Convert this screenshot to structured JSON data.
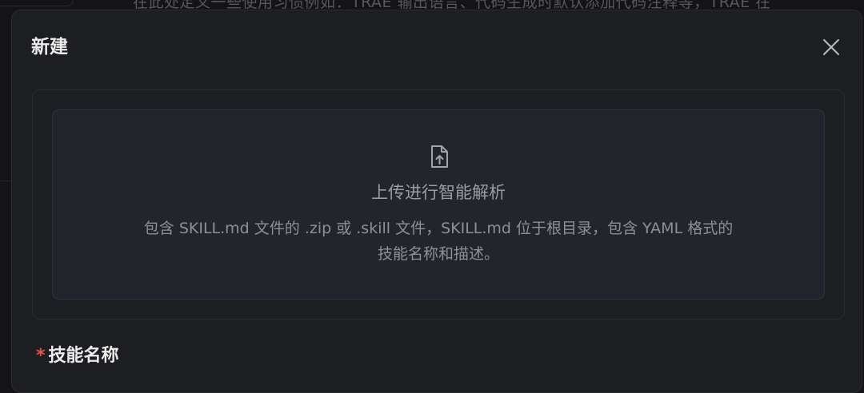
{
  "background": {
    "hint_text": "在此处定义一些使用习惯例如：TRAE 输出语言、代码生成时默认添加代码注释等，TRAE 在"
  },
  "modal": {
    "title": "新建",
    "close_icon": "close-icon",
    "upload": {
      "icon": "file-upload-icon",
      "title": "上传进行智能解析",
      "description_line1": "包含 SKILL.md 文件的 .zip 或 .skill 文件，SKILL.md 位于根目录，包含 YAML 格式的",
      "description_line2": "技能名称和描述。"
    },
    "field": {
      "required_mark": "*",
      "label": "技能名称"
    }
  },
  "colors": {
    "page_bg": "#141416",
    "modal_bg": "#1d1e22",
    "upload_bg": "#22252b",
    "required": "#e5534b"
  }
}
